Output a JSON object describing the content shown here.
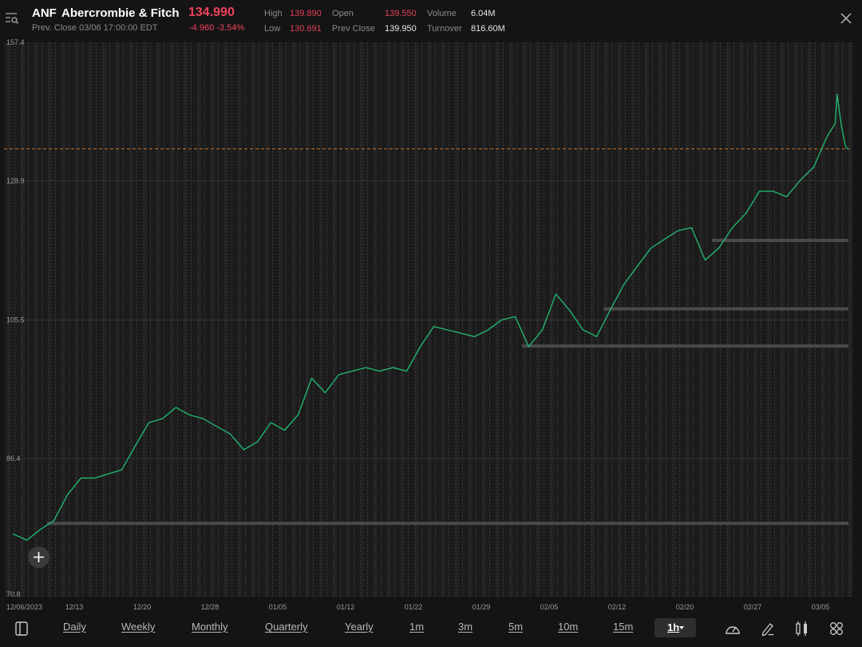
{
  "header": {
    "symbol": "ANF",
    "name": "Abercrombie & Fitch",
    "last_price": "134.990",
    "prev_close_time": "Prev. Close 03/06 17:00:00 EDT",
    "change": "-4.960",
    "change_pct": "-3.54%",
    "stats": {
      "high_label": "High",
      "high": "139.890",
      "low_label": "Low",
      "low": "130.691",
      "open_label": "Open",
      "open": "139.550",
      "prev_close_label": "Prev Close",
      "prev_close": "139.950",
      "volume_label": "Volume",
      "volume": "6.04M",
      "turnover_label": "Turnover",
      "turnover": "816.60M"
    }
  },
  "toolbar": {
    "timeframes": [
      "Daily",
      "Weekly",
      "Monthly",
      "Quarterly",
      "Yearly",
      "1m",
      "3m",
      "5m",
      "10m",
      "15m"
    ],
    "selected_timeframe": "1h",
    "icons": [
      "layout-toggle-icon",
      "speedometer-icon",
      "pen-icon",
      "candlestick-icon",
      "grid-icon"
    ]
  },
  "colors": {
    "up_line": "#22b36d",
    "negative": "#f0445e",
    "last_price_line": "#c8792a",
    "background": "#1b1b1b"
  },
  "chart_data": {
    "type": "line",
    "y_scale": "log",
    "ylim": [
      70.8,
      157.4
    ],
    "y_ticks": [
      "157.4",
      "128.9",
      "105.5",
      "86.4",
      "70.8"
    ],
    "x_ticks": [
      "12/06/2023",
      "12/13",
      "12/20",
      "12/28",
      "01/05",
      "01/12",
      "01/22",
      "01/29",
      "02/05",
      "02/12",
      "02/20",
      "02/27",
      "03/05"
    ],
    "last_price_line": 134.99,
    "grid": "vertical dotted",
    "price_levels": [
      {
        "from": "12/11",
        "price": 78.7
      },
      {
        "from": "02/01",
        "price": 101.6
      },
      {
        "from": "02/09",
        "price": 107.2
      },
      {
        "from": "02/22",
        "price": 118.3
      }
    ],
    "series": [
      {
        "points": [
          [
            "12/06",
            77.5
          ],
          [
            "12/07",
            76.8
          ],
          [
            "12/08",
            78
          ],
          [
            "12/11",
            79
          ],
          [
            "12/12",
            82
          ],
          [
            "12/13",
            84
          ],
          [
            "12/14",
            84
          ],
          [
            "12/15",
            84.5
          ],
          [
            "12/18",
            85
          ],
          [
            "12/19",
            88
          ],
          [
            "12/20",
            91
          ],
          [
            "12/21",
            91.5
          ],
          [
            "12/22",
            93
          ],
          [
            "12/26",
            92
          ],
          [
            "12/27",
            91.5
          ],
          [
            "12/28",
            90.5
          ],
          [
            "12/29",
            89.5
          ],
          [
            "01/02",
            87.5
          ],
          [
            "01/03",
            88.5
          ],
          [
            "01/04",
            91
          ],
          [
            "01/05",
            90
          ],
          [
            "01/08",
            92
          ],
          [
            "01/09",
            97
          ],
          [
            "01/10",
            95
          ],
          [
            "01/11",
            97.5
          ],
          [
            "01/12",
            98
          ],
          [
            "01/16",
            98.5
          ],
          [
            "01/17",
            98
          ],
          [
            "01/18",
            98.5
          ],
          [
            "01/19",
            98
          ],
          [
            "01/22",
            101.5
          ],
          [
            "01/23",
            104.5
          ],
          [
            "01/24",
            104
          ],
          [
            "01/25",
            103.5
          ],
          [
            "01/26",
            103
          ],
          [
            "01/29",
            104
          ],
          [
            "01/30",
            105.5
          ],
          [
            "01/31",
            106
          ],
          [
            "02/01",
            101.5
          ],
          [
            "02/02",
            104
          ],
          [
            "02/05",
            109.5
          ],
          [
            "02/06",
            107
          ],
          [
            "02/07",
            104
          ],
          [
            "02/08",
            103
          ],
          [
            "02/09",
            107
          ],
          [
            "02/12",
            111
          ],
          [
            "02/13",
            114
          ],
          [
            "02/14",
            117
          ],
          [
            "02/15",
            118.5
          ],
          [
            "02/16",
            120
          ],
          [
            "02/20",
            120.5
          ],
          [
            "02/21",
            115
          ],
          [
            "02/22",
            117
          ],
          [
            "02/23",
            120.5
          ],
          [
            "02/26",
            123
          ],
          [
            "02/27",
            127
          ],
          [
            "02/28",
            127
          ],
          [
            "02/29",
            126
          ],
          [
            "03/01",
            129
          ],
          [
            "03/04",
            131.5
          ],
          [
            "03/05",
            137.5
          ],
          [
            "03/06 10:00",
            140
          ],
          [
            "03/06 11:00",
            146
          ],
          [
            "03/06 13:00",
            139.5
          ],
          [
            "03/06 15:00",
            135.5
          ],
          [
            "03/06 16:00",
            134.99
          ]
        ]
      }
    ]
  }
}
